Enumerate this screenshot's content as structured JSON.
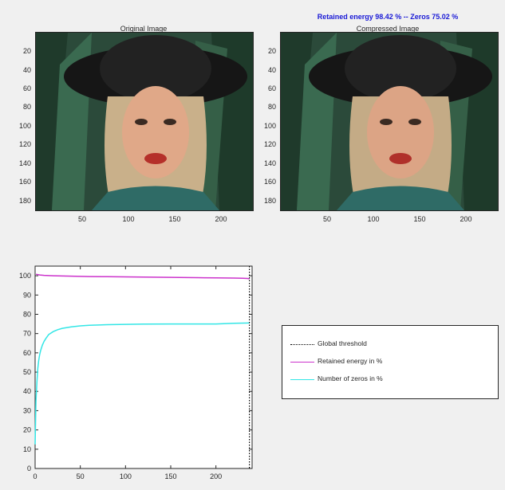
{
  "figure": {
    "suptitle": "Retained energy 98.42 % -- Zeros 75.02 %"
  },
  "original": {
    "title": "Original Image",
    "y_ticks": [
      "20",
      "40",
      "60",
      "80",
      "100",
      "120",
      "140",
      "160",
      "180"
    ],
    "x_ticks": [
      "50",
      "100",
      "150",
      "200"
    ]
  },
  "compressed": {
    "title": "Compressed Image",
    "y_ticks": [
      "20",
      "40",
      "60",
      "80",
      "100",
      "120",
      "140",
      "160",
      "180"
    ],
    "x_ticks": [
      "50",
      "100",
      "150",
      "200"
    ]
  },
  "legend": {
    "items": [
      {
        "label": "Global threshold",
        "color": "#000000",
        "style": "dotted"
      },
      {
        "label": "Retained energy in %",
        "color": "#cc33cc",
        "style": "solid"
      },
      {
        "label": "Number of zeros in %",
        "color": "#33e6e6",
        "style": "solid"
      }
    ]
  },
  "chart_data": {
    "type": "line",
    "xlim": [
      0,
      240
    ],
    "ylim": [
      0,
      105
    ],
    "x_ticks": [
      0,
      50,
      100,
      150,
      200
    ],
    "y_ticks": [
      0,
      10,
      20,
      30,
      40,
      50,
      60,
      70,
      80,
      90,
      100
    ],
    "grid": false,
    "legend_placement": "outside-right",
    "threshold_x": 237,
    "series": [
      {
        "name": "Retained energy in %",
        "color": "#cc33cc",
        "x": [
          1,
          5,
          10,
          20,
          40,
          60,
          80,
          100,
          120,
          140,
          160,
          180,
          200,
          220,
          230,
          235,
          237
        ],
        "y": [
          100.8,
          100.4,
          100.2,
          100.0,
          99.8,
          99.6,
          99.5,
          99.4,
          99.3,
          99.2,
          99.1,
          99.0,
          98.9,
          98.8,
          98.7,
          98.6,
          98.4
        ]
      },
      {
        "name": "Number of zeros in %",
        "color": "#33e6e6",
        "x": [
          0,
          1,
          2,
          3,
          4,
          5,
          6,
          8,
          10,
          12,
          15,
          20,
          25,
          30,
          40,
          50,
          60,
          80,
          100,
          120,
          150,
          180,
          200,
          220,
          237
        ],
        "y": [
          12.5,
          35,
          45,
          52,
          56,
          59,
          61,
          64,
          66,
          67.5,
          69.5,
          71,
          72,
          72.7,
          73.5,
          74,
          74.3,
          74.6,
          74.8,
          74.9,
          75.0,
          75.0,
          75.0,
          75.3,
          75.5
        ]
      }
    ]
  }
}
